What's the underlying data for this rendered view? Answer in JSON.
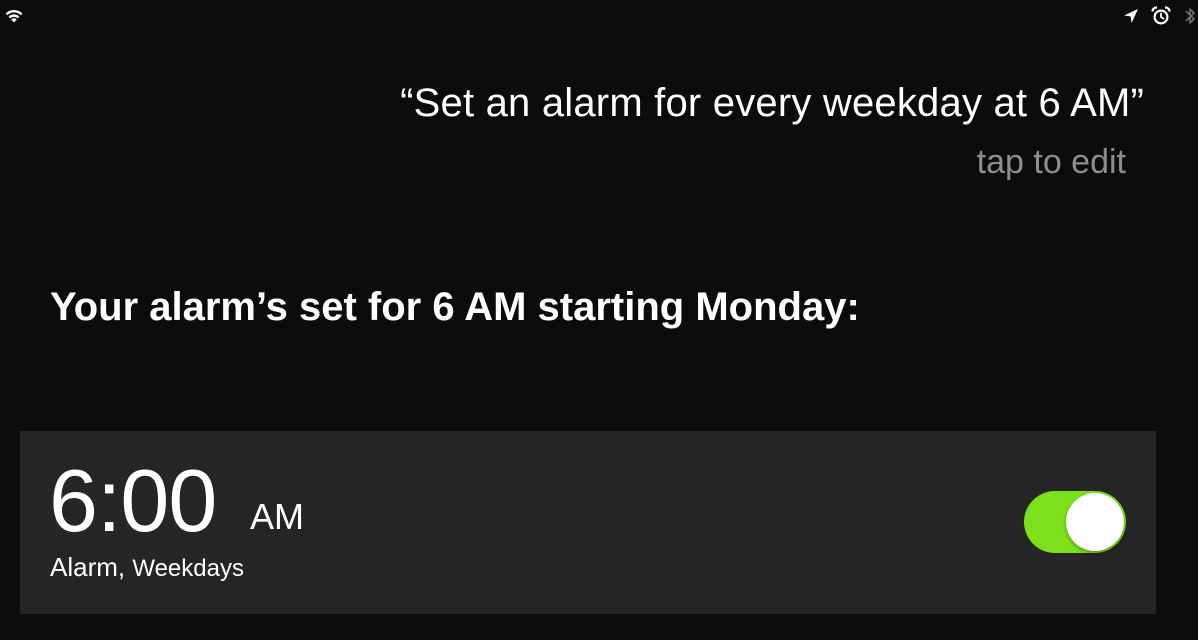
{
  "status_bar": {
    "left_icon": "wifi-icon",
    "right_icons": [
      "location-arrow-icon",
      "alarm-clock-icon",
      "bluetooth-icon"
    ]
  },
  "query": {
    "text": "“Set an alarm for every weekday at 6 AM”",
    "edit_hint": "tap to edit"
  },
  "response": {
    "text": "Your alarm’s set for 6 AM starting Monday:"
  },
  "alarm": {
    "time": "6:00",
    "ampm": "AM",
    "label": "Alarm,",
    "repeat": "Weekdays",
    "enabled": true,
    "toggle_color": "#7ce11a"
  }
}
